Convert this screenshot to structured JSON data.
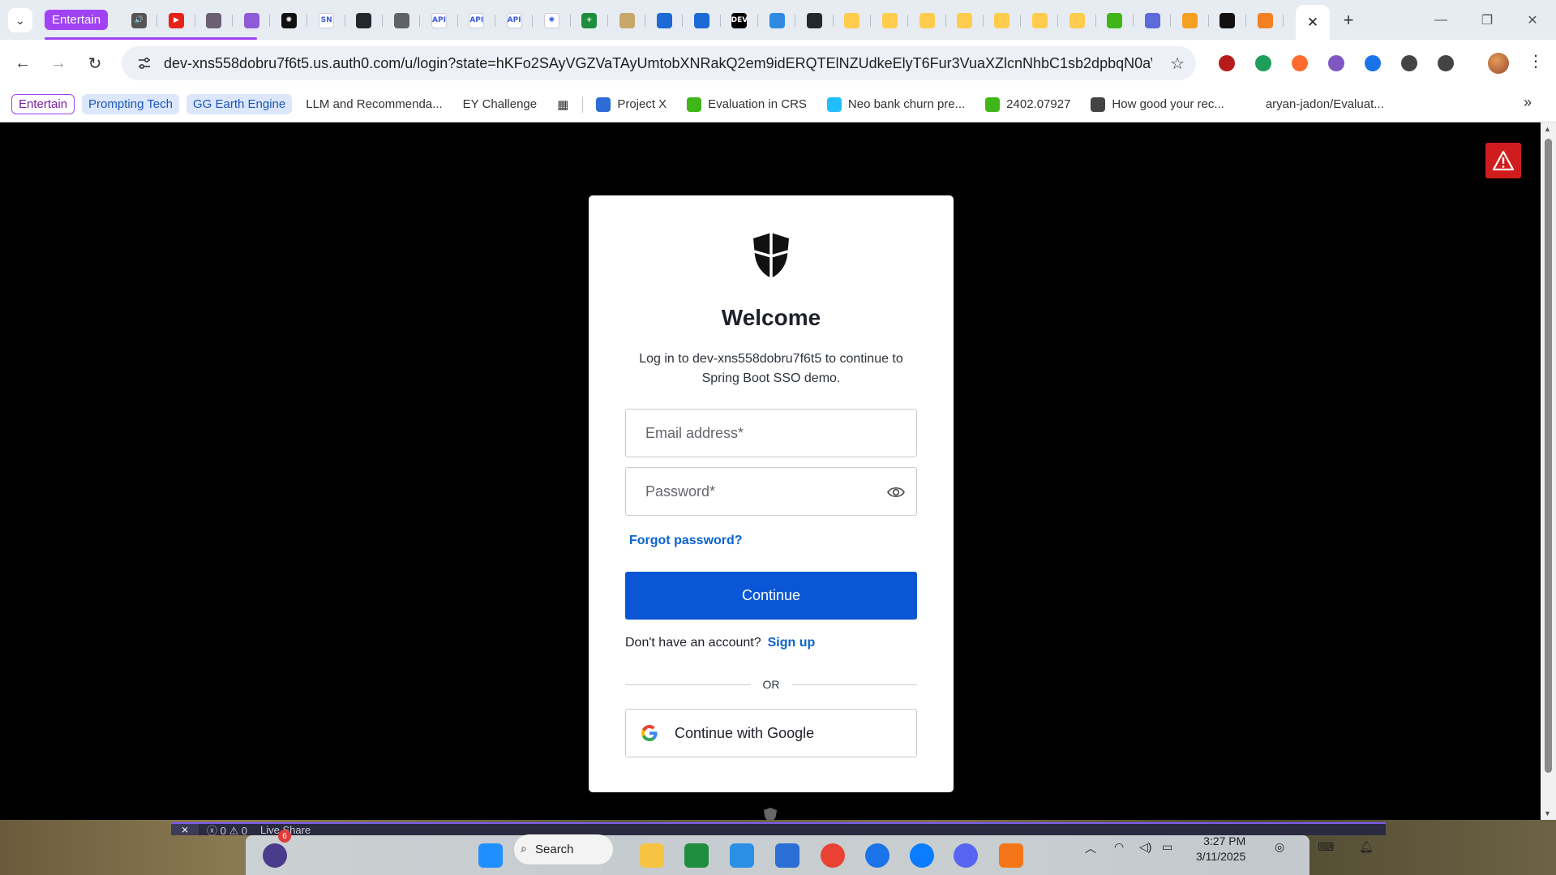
{
  "browser": {
    "tab_group_label": "Entertain",
    "new_tab_symbol": "+",
    "close_tab_symbol": "✕",
    "tab_favicons": [
      {
        "name": "speaker-tab",
        "color": "#555555",
        "glyph": "🔊"
      },
      {
        "name": "youtube-tab",
        "color": "#e62117",
        "glyph": "▶"
      },
      {
        "name": "anime-tab",
        "color": "#6a5f73",
        "glyph": ""
      },
      {
        "name": "pencil-tab",
        "color": "#8f5ad6",
        "glyph": ""
      },
      {
        "name": "chatgpt-tab",
        "color": "#111111",
        "glyph": "✺"
      },
      {
        "name": "sn-tab",
        "color": "#ffffff",
        "glyph": "SN"
      },
      {
        "name": "github-tab-1",
        "color": "#24292f",
        "glyph": ""
      },
      {
        "name": "globe-tab",
        "color": "#5f6368",
        "glyph": ""
      },
      {
        "name": "api-tab-1",
        "color": "#ffffff",
        "glyph": "API"
      },
      {
        "name": "api-tab-2",
        "color": "#ffffff",
        "glyph": "API"
      },
      {
        "name": "api-tab-3",
        "color": "#ffffff",
        "glyph": "API"
      },
      {
        "name": "openai-tab",
        "color": "#ffffff",
        "glyph": "✺"
      },
      {
        "name": "sheets-tab",
        "color": "#1e8e3e",
        "glyph": "+"
      },
      {
        "name": "spinner-tab",
        "color": "#c7a76a",
        "glyph": ""
      },
      {
        "name": "edge-tab-1",
        "color": "#1c6ad6",
        "glyph": ""
      },
      {
        "name": "edge-tab-2",
        "color": "#1c6ad6",
        "glyph": ""
      },
      {
        "name": "dev-tab",
        "color": "#000000",
        "glyph": "DEV"
      },
      {
        "name": "edge-tab-3",
        "color": "#2f8ae0",
        "glyph": ""
      },
      {
        "name": "github-tab-2",
        "color": "#24292f",
        "glyph": ""
      },
      {
        "name": "huggingface-tab-1",
        "color": "#ffcc4d",
        "glyph": ""
      },
      {
        "name": "huggingface-tab-2",
        "color": "#ffcc4d",
        "glyph": ""
      },
      {
        "name": "huggingface-tab-3",
        "color": "#ffcc4d",
        "glyph": ""
      },
      {
        "name": "huggingface-tab-4",
        "color": "#ffcc4d",
        "glyph": ""
      },
      {
        "name": "huggingface-tab-5",
        "color": "#ffcc4d",
        "glyph": ""
      },
      {
        "name": "huggingface-tab-6",
        "color": "#ffcc4d",
        "glyph": ""
      },
      {
        "name": "huggingface-tab-7",
        "color": "#ffcc4d",
        "glyph": ""
      },
      {
        "name": "smiley-tab",
        "color": "#3fb618",
        "glyph": ""
      },
      {
        "name": "wave-tab",
        "color": "#5b6bd8",
        "glyph": ""
      },
      {
        "name": "orange-tab",
        "color": "#f4a020",
        "glyph": ""
      },
      {
        "name": "auth0-tab",
        "color": "#111111",
        "glyph": ""
      },
      {
        "name": "stack-tab",
        "color": "#f48024",
        "glyph": ""
      }
    ],
    "url": "dev-xns558dobru7f6t5.us.auth0.com/u/login?state=hKFo2SAyVGZVaTAyUmtobXNRakQ2em9idERQTElNZUdkeElyT6Fur3VuaXZlcnNhbC1sb2dpbqN0aWTZIEp...",
    "extensions": [
      {
        "name": "shield-extension-icon",
        "color": "#b71c1c"
      },
      {
        "name": "pen-extension-icon",
        "color": "#1e9e5a"
      },
      {
        "name": "fire-extension-icon",
        "color": "#ff6d2e"
      },
      {
        "name": "color-extension-icon",
        "color": "#7e57c2"
      },
      {
        "name": "feather-extension-icon",
        "color": "#1a73e8"
      },
      {
        "name": "puzzle-extension-icon",
        "color": "#444444"
      },
      {
        "name": "media-extension-icon",
        "color": "#444444"
      }
    ]
  },
  "bookmarks": [
    {
      "label": "Entertain",
      "kind": "chip"
    },
    {
      "label": "Prompting Tech",
      "kind": "group"
    },
    {
      "label": "GG Earth Engine",
      "kind": "group"
    },
    {
      "label": "LLM and Recommenda...",
      "kind": "plain"
    },
    {
      "label": "EY Challenge",
      "kind": "plain"
    },
    {
      "label": "",
      "kind": "apps"
    },
    {
      "label": "Project X",
      "kind": "icon",
      "color": "#2d6bd6"
    },
    {
      "label": "Evaluation in CRS",
      "kind": "icon",
      "color": "#3fb618"
    },
    {
      "label": "Neo bank churn pre...",
      "kind": "icon",
      "color": "#20beff"
    },
    {
      "label": "2402.07927",
      "kind": "icon",
      "color": "#3fb618"
    },
    {
      "label": "How good your rec...",
      "kind": "icon",
      "color": "#444444"
    },
    {
      "label": "aryan-jadon/Evaluat...",
      "kind": "icon",
      "color": "#ffffff"
    }
  ],
  "bookmarks_more": "»",
  "login": {
    "title": "Welcome",
    "subtitle": "Log in to dev-xns558dobru7f6t5 to continue to Spring Boot SSO demo.",
    "email_placeholder": "Email address*",
    "email_value": "",
    "password_placeholder": "Password*",
    "password_value": "",
    "forgot_password": "Forgot password?",
    "continue_label": "Continue",
    "no_account_text": "Don't have an account?",
    "signup_label": "Sign up",
    "divider_text": "OR",
    "google_label": "Continue with Google",
    "accent_color": "#0a56d6"
  },
  "taskbar": {
    "status_bar": {
      "errors": "0",
      "warnings": "0",
      "live_share": "Live Share"
    },
    "search_label": "Search",
    "notification_count": "6",
    "time": "3:27 PM",
    "date": "3/11/2025",
    "apps": [
      {
        "name": "windows-start-icon",
        "color": "#1f8fff"
      },
      {
        "name": "file-explorer-icon",
        "color": "#f6c343"
      },
      {
        "name": "sheets-app-icon",
        "color": "#1e8e3e"
      },
      {
        "name": "vscode-icon",
        "color": "#2b8fe6"
      },
      {
        "name": "microsoft-store-icon",
        "color": "#2b6fd6"
      },
      {
        "name": "chrome-icon",
        "color": "#e94235"
      },
      {
        "name": "zalo-icon",
        "color": "#1a73e8"
      },
      {
        "name": "messenger-icon",
        "color": "#0a7cff"
      },
      {
        "name": "discord-icon",
        "color": "#5865f2"
      },
      {
        "name": "pdf-app-icon",
        "color": "#f5761a"
      }
    ]
  }
}
